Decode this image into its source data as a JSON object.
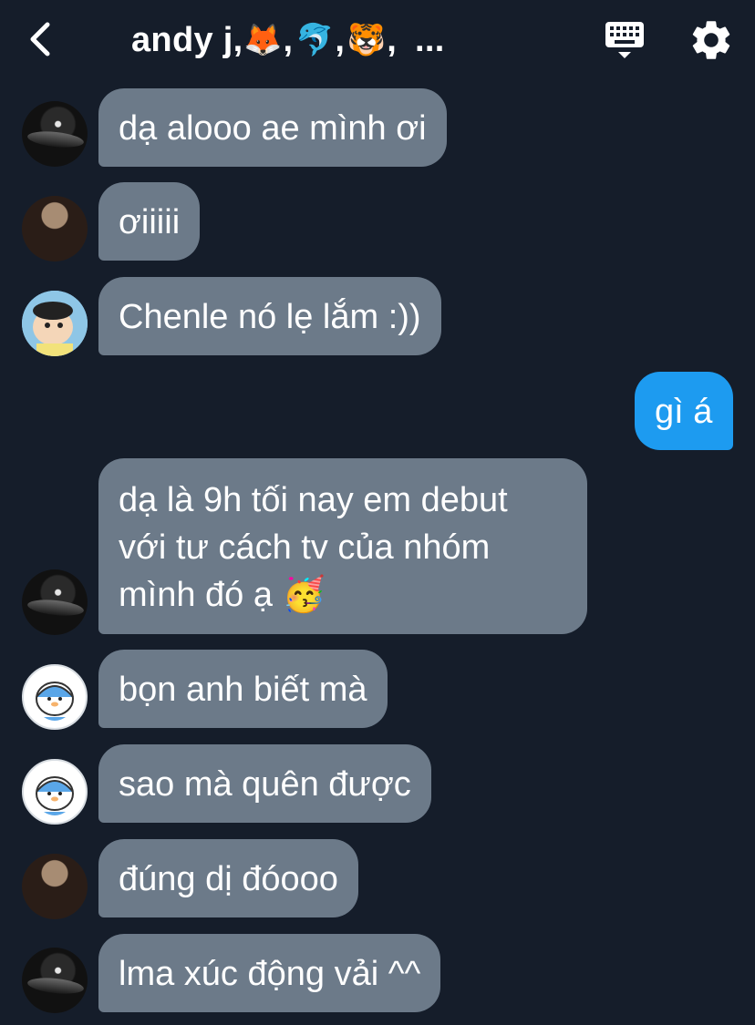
{
  "header": {
    "title_name": "andy j,",
    "title_emojis": [
      "🦊",
      "🐬",
      "🐯"
    ],
    "title_commas": [
      ",",
      ",",
      ","
    ],
    "title_more": "..."
  },
  "icons": {
    "back": "chevron-left-icon",
    "keyboard": "keyboard-icon",
    "settings": "gear-icon"
  },
  "colors": {
    "background": "#151d2a",
    "incoming_bubble": "#6c7a89",
    "outgoing_bubble": "#1d9bf0",
    "text": "#ffffff"
  },
  "messages": [
    {
      "direction": "incoming",
      "avatar": "dark-avatar",
      "text": "dạ alooo ae mình ơi"
    },
    {
      "direction": "incoming",
      "avatar": "girl-avatar",
      "text": "ơiiiii"
    },
    {
      "direction": "incoming",
      "avatar": "shinchan-avatar",
      "text": "Chenle nó lẹ lắm :))"
    },
    {
      "direction": "outgoing",
      "text": "gì á"
    },
    {
      "direction": "incoming",
      "avatar": "dark-avatar",
      "lines": [
        "dạ là 9h tối nay em debut",
        "với tư cách tv của nhóm",
        "mình đó ạ 🥳"
      ]
    },
    {
      "direction": "incoming",
      "avatar": "penguin-avatar",
      "text": "bọn anh biết mà"
    },
    {
      "direction": "incoming",
      "avatar": "penguin-avatar",
      "text": "sao mà quên được"
    },
    {
      "direction": "incoming",
      "avatar": "girl-avatar",
      "text": "đúng dị đóooo"
    },
    {
      "direction": "incoming",
      "avatar": "dark-avatar",
      "text": "lma xúc động vải ^^"
    }
  ]
}
